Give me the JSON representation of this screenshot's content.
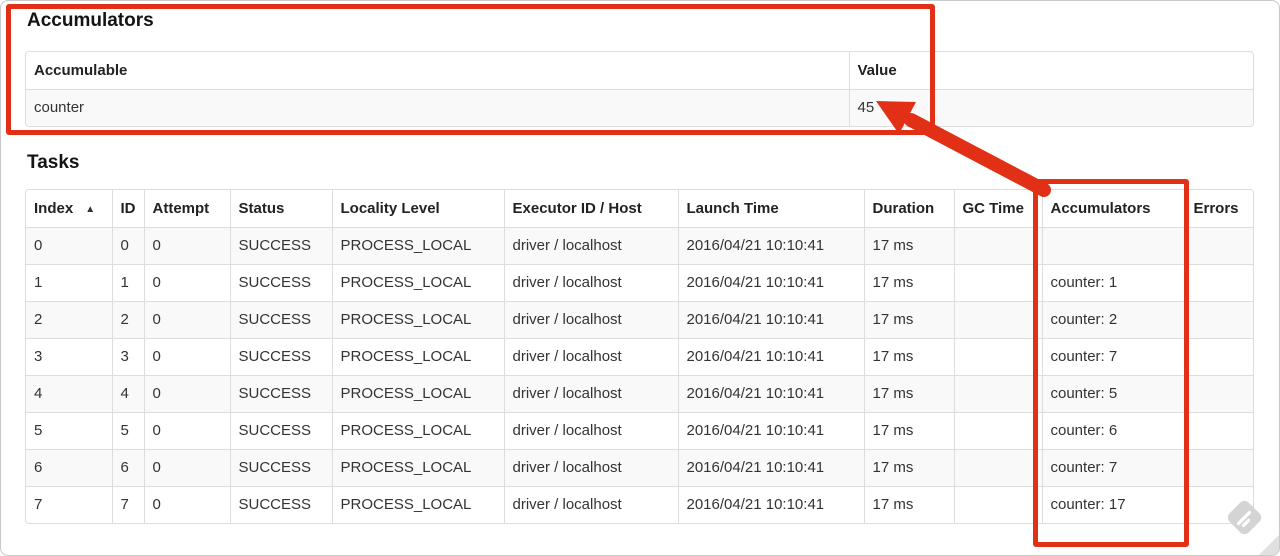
{
  "colors": {
    "annotation_red": "#e23017",
    "table_border": "#dddddd",
    "row_stripe": "#f9f9f9",
    "watermark_gray": "#d4d4d4"
  },
  "accumulators_section": {
    "heading": "Accumulators",
    "table": {
      "headers": [
        "Accumulable",
        "Value"
      ],
      "rows": [
        {
          "accumulable": "counter",
          "value": "45"
        }
      ]
    }
  },
  "tasks_section": {
    "heading": "Tasks",
    "table": {
      "headers": [
        "Index",
        "ID",
        "Attempt",
        "Status",
        "Locality Level",
        "Executor ID / Host",
        "Launch Time",
        "Duration",
        "GC Time",
        "Accumulators",
        "Errors"
      ],
      "sort_indicator": "▲",
      "rows": [
        {
          "index": "0",
          "id": "0",
          "attempt": "0",
          "status": "SUCCESS",
          "locality": "PROCESS_LOCAL",
          "executor": "driver / localhost",
          "launch_time": "2016/04/21 10:10:41",
          "duration": "17 ms",
          "gc_time": "",
          "accumulators": "",
          "errors": ""
        },
        {
          "index": "1",
          "id": "1",
          "attempt": "0",
          "status": "SUCCESS",
          "locality": "PROCESS_LOCAL",
          "executor": "driver / localhost",
          "launch_time": "2016/04/21 10:10:41",
          "duration": "17 ms",
          "gc_time": "",
          "accumulators": "counter: 1",
          "errors": ""
        },
        {
          "index": "2",
          "id": "2",
          "attempt": "0",
          "status": "SUCCESS",
          "locality": "PROCESS_LOCAL",
          "executor": "driver / localhost",
          "launch_time": "2016/04/21 10:10:41",
          "duration": "17 ms",
          "gc_time": "",
          "accumulators": "counter: 2",
          "errors": ""
        },
        {
          "index": "3",
          "id": "3",
          "attempt": "0",
          "status": "SUCCESS",
          "locality": "PROCESS_LOCAL",
          "executor": "driver / localhost",
          "launch_time": "2016/04/21 10:10:41",
          "duration": "17 ms",
          "gc_time": "",
          "accumulators": "counter: 7",
          "errors": ""
        },
        {
          "index": "4",
          "id": "4",
          "attempt": "0",
          "status": "SUCCESS",
          "locality": "PROCESS_LOCAL",
          "executor": "driver / localhost",
          "launch_time": "2016/04/21 10:10:41",
          "duration": "17 ms",
          "gc_time": "",
          "accumulators": "counter: 5",
          "errors": ""
        },
        {
          "index": "5",
          "id": "5",
          "attempt": "0",
          "status": "SUCCESS",
          "locality": "PROCESS_LOCAL",
          "executor": "driver / localhost",
          "launch_time": "2016/04/21 10:10:41",
          "duration": "17 ms",
          "gc_time": "",
          "accumulators": "counter: 6",
          "errors": ""
        },
        {
          "index": "6",
          "id": "6",
          "attempt": "0",
          "status": "SUCCESS",
          "locality": "PROCESS_LOCAL",
          "executor": "driver / localhost",
          "launch_time": "2016/04/21 10:10:41",
          "duration": "17 ms",
          "gc_time": "",
          "accumulators": "counter: 7",
          "errors": ""
        },
        {
          "index": "7",
          "id": "7",
          "attempt": "0",
          "status": "SUCCESS",
          "locality": "PROCESS_LOCAL",
          "executor": "driver / localhost",
          "launch_time": "2016/04/21 10:10:41",
          "duration": "17 ms",
          "gc_time": "",
          "accumulators": "counter: 17",
          "errors": ""
        }
      ]
    }
  }
}
